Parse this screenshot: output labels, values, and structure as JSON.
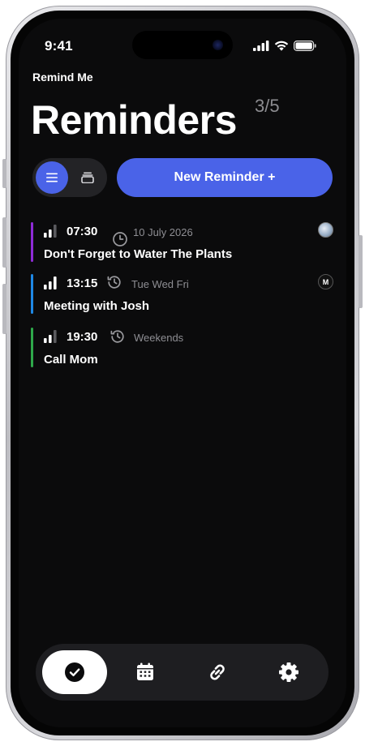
{
  "status_bar": {
    "time": "9:41",
    "icons": [
      "cellular-signal-icon",
      "wifi-icon",
      "battery-icon"
    ]
  },
  "app": {
    "name": "Remind Me",
    "title": "Reminders",
    "count": "3/5"
  },
  "controls": {
    "view_modes": [
      "list-view-icon",
      "stack-view-icon"
    ],
    "active_view": "list-view-icon",
    "new_button_label": "New Reminder +"
  },
  "colors": {
    "accent": "#4a63e8",
    "priority_purple": "#8e2bd6",
    "priority_blue": "#1e88e5",
    "priority_green": "#2ea84a"
  },
  "reminders": [
    {
      "time": "07:30",
      "schedule": "10 July 2026",
      "schedule_icon": "clock-icon",
      "title": "Don't Forget to Water The Plants",
      "avatar": "photo-avatar",
      "color": "#8e2bd6",
      "priority_bars": 2
    },
    {
      "time": "13:15",
      "schedule": "Tue Wed Fri",
      "schedule_icon": "recurring-history-icon",
      "title": "Meeting with Josh",
      "avatar": "M",
      "color": "#1e88e5",
      "priority_bars": 3
    },
    {
      "time": "19:30",
      "schedule": "Weekends",
      "schedule_icon": "recurring-history-icon",
      "title": "Call Mom",
      "avatar": "",
      "color": "#2ea84a",
      "priority_bars": 2
    }
  ],
  "tabbar": {
    "tabs": [
      "checkmark-icon",
      "calendar-icon",
      "link-icon",
      "gear-icon"
    ],
    "active": "checkmark-icon"
  }
}
